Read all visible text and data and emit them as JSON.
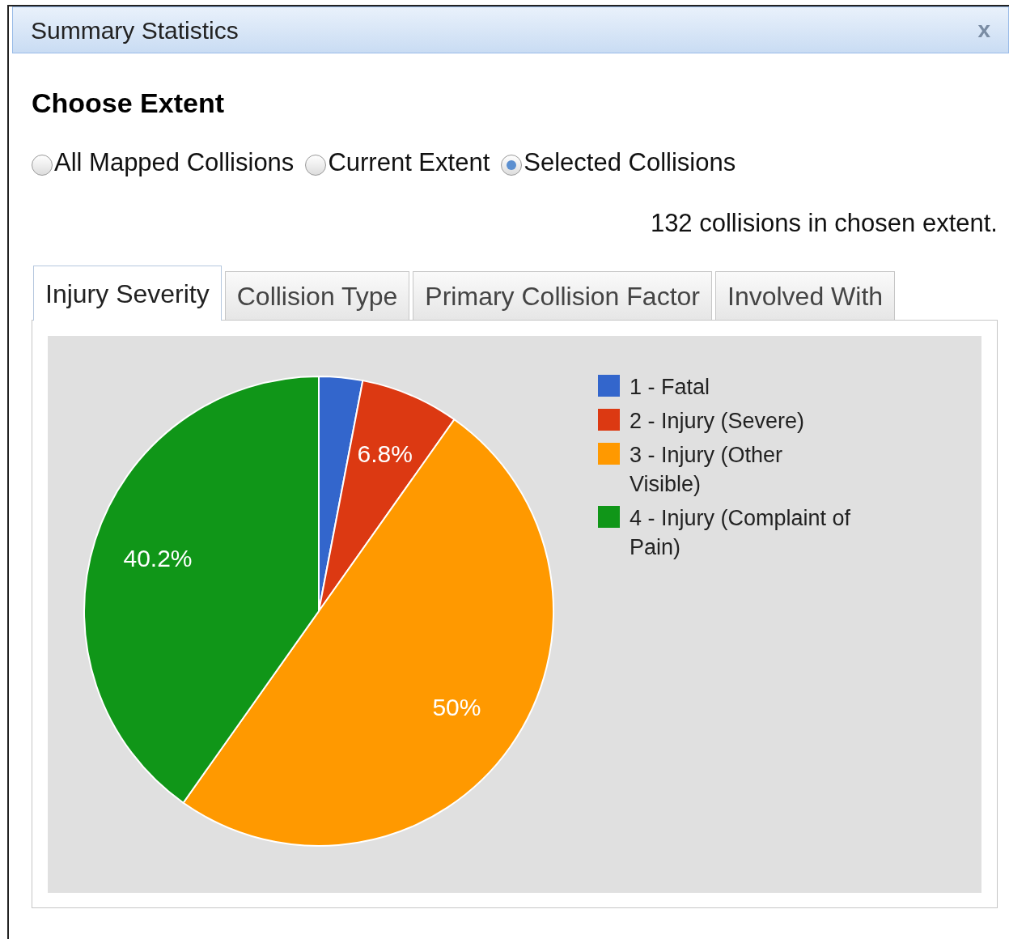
{
  "window": {
    "title": "Summary Statistics",
    "close": "x"
  },
  "heading": "Choose Extent",
  "extent_options": [
    {
      "label": "All Mapped Collisions",
      "selected": false
    },
    {
      "label": "Current Extent",
      "selected": false
    },
    {
      "label": "Selected Collisions",
      "selected": true
    }
  ],
  "count_text": "132 collisions in chosen extent.",
  "tabs": [
    {
      "label": "Injury Severity",
      "selected": true
    },
    {
      "label": "Collision Type",
      "selected": false
    },
    {
      "label": "Primary Collision Factor",
      "selected": false
    },
    {
      "label": "Involved With",
      "selected": false
    }
  ],
  "chart_data": {
    "type": "pie",
    "categories": [
      "1 - Fatal",
      "2 - Injury (Severe)",
      "3 - Injury (Other Visible)",
      "4 - Injury (Complaint of Pain)"
    ],
    "values": [
      3.0,
      6.8,
      50,
      40.2
    ],
    "colors": [
      "#3366cc",
      "#dc3912",
      "#ff9900",
      "#109618"
    ],
    "value_labels": [
      null,
      "6.8%",
      "50%",
      "40.2%"
    ]
  }
}
